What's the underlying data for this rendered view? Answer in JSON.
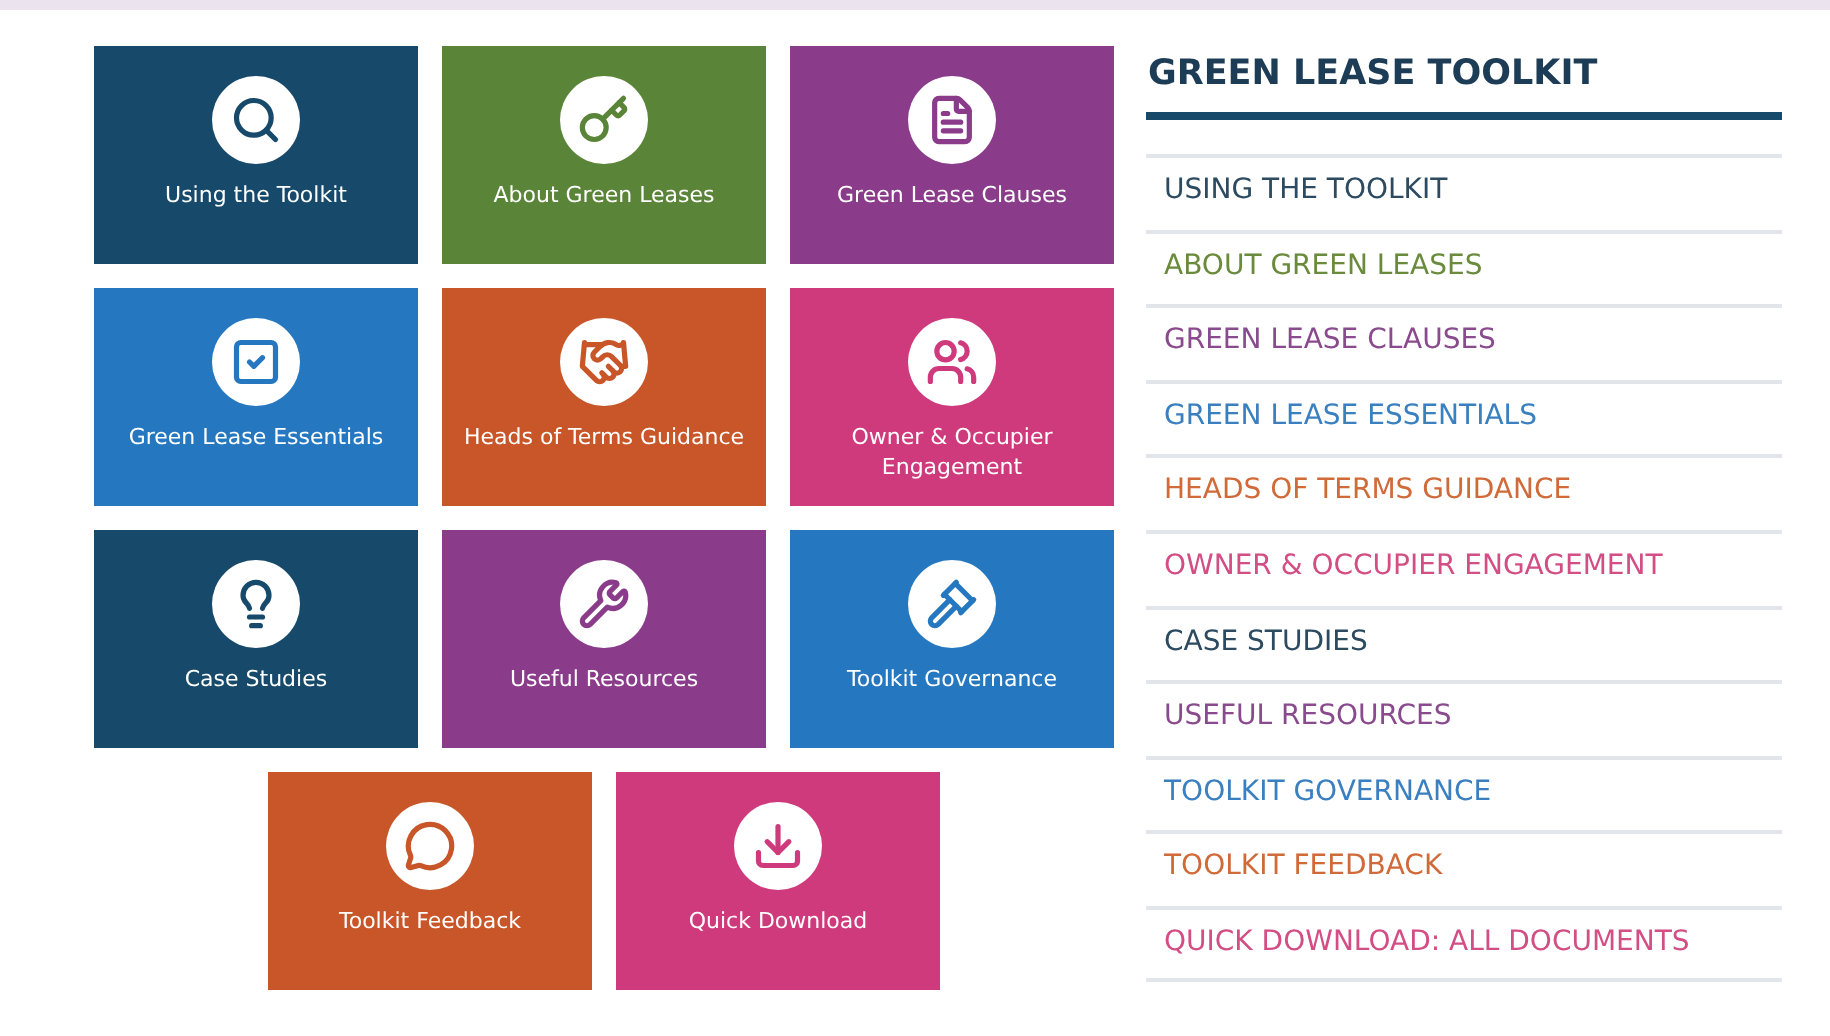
{
  "tiles": [
    {
      "label": "Using the Toolkit",
      "color": "#174a6a"
    },
    {
      "label": "About Green Leases",
      "color": "#5a8438"
    },
    {
      "label": "Green Lease Clauses",
      "color": "#8a3b8a"
    },
    {
      "label": "Green Lease Essentials",
      "color": "#2578c0"
    },
    {
      "label": "Heads of Terms Guidance",
      "color": "#c85628"
    },
    {
      "label": "Owner & Occupier Engagement",
      "color": "#cf3a7c"
    },
    {
      "label": "Case Studies",
      "color": "#174a6a"
    },
    {
      "label": "Useful Resources",
      "color": "#8a3b8a"
    },
    {
      "label": "Toolkit Governance",
      "color": "#2578c0"
    },
    {
      "label": "Toolkit Feedback",
      "color": "#c85628"
    },
    {
      "label": "Quick Download",
      "color": "#cf3a7c"
    }
  ],
  "sidebar": {
    "title": "GREEN LEASE TOOLKIT",
    "items": [
      {
        "label": "USING THE TOOLKIT",
        "color": "#2c4a60"
      },
      {
        "label": "ABOUT GREEN LEASES",
        "color": "#6a8a3c"
      },
      {
        "label": "GREEN LEASE CLAUSES",
        "color": "#8a4a8e"
      },
      {
        "label": "GREEN LEASE ESSENTIALS",
        "color": "#3a80c0"
      },
      {
        "label": "HEADS OF TERMS GUIDANCE",
        "color": "#d06a38"
      },
      {
        "label": "OWNER & OCCUPIER ENGAGEMENT",
        "color": "#d24e84"
      },
      {
        "label": "CASE STUDIES",
        "color": "#2c4a60"
      },
      {
        "label": "USEFUL RESOURCES",
        "color": "#8a4a8e"
      },
      {
        "label": "TOOLKIT GOVERNANCE",
        "color": "#3a80c0"
      },
      {
        "label": "TOOLKIT FEEDBACK",
        "color": "#d06a38"
      },
      {
        "label": "QUICK DOWNLOAD: ALL DOCUMENTS",
        "color": "#d24e84"
      }
    ]
  }
}
